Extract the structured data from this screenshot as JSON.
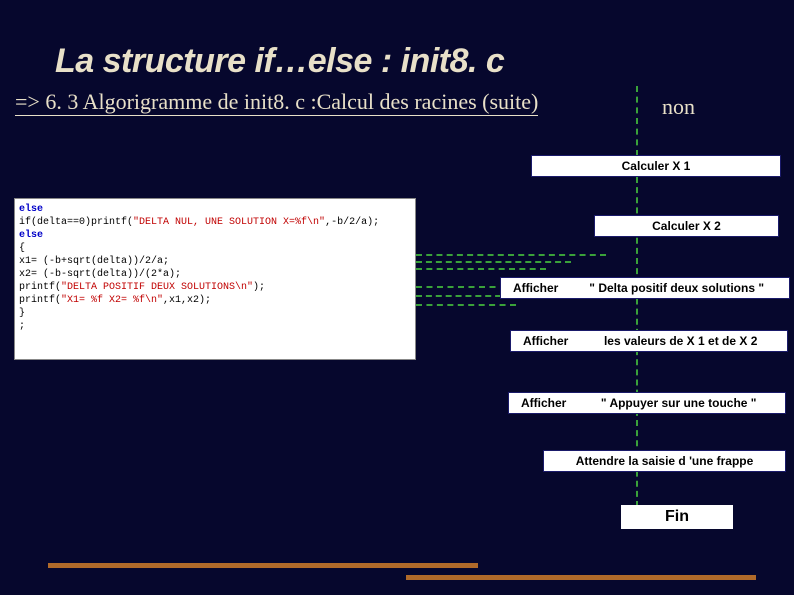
{
  "title": "La structure if…else : init8. c",
  "subtitle": "=> 6. 3 Algorigramme de init8. c :Calcul des racines (suite)",
  "branch_label": "non",
  "code": {
    "kw_else1": "else",
    "line2a": "    if(delta==0)printf(",
    "line2s": "\"DELTA NUL, UNE SOLUTION X=%f\\n\"",
    "line2b": ",-b/2/a);",
    "kw_else2": "    else",
    "line4": "        {",
    "line5": "        x1= (-b+sqrt(delta))/2/a;",
    "line6": "        x2= (-b-sqrt(delta))/(2*a);",
    "line7a": "        printf(",
    "line7s": "\"DELTA POSITIF DEUX SOLUTIONS\\n\"",
    "line7b": ");",
    "line8a": "        printf(",
    "line8s": "\"X1= %f   X2= %f\\n\"",
    "line8b": ",x1,x2);",
    "line9": "        }",
    "line10": ";"
  },
  "flow": {
    "calc1": "Calculer X 1",
    "calc2": "Calculer X 2",
    "aff_lbl": "Afficher",
    "aff1_msg": "\" Delta positif deux solutions  \"",
    "aff2_msg": "les valeurs de X 1 et de X 2",
    "aff3_msg": "\" Appuyer sur une touche  \"",
    "wait": "Attendre la saisie d 'une frappe",
    "fin": "Fin"
  }
}
